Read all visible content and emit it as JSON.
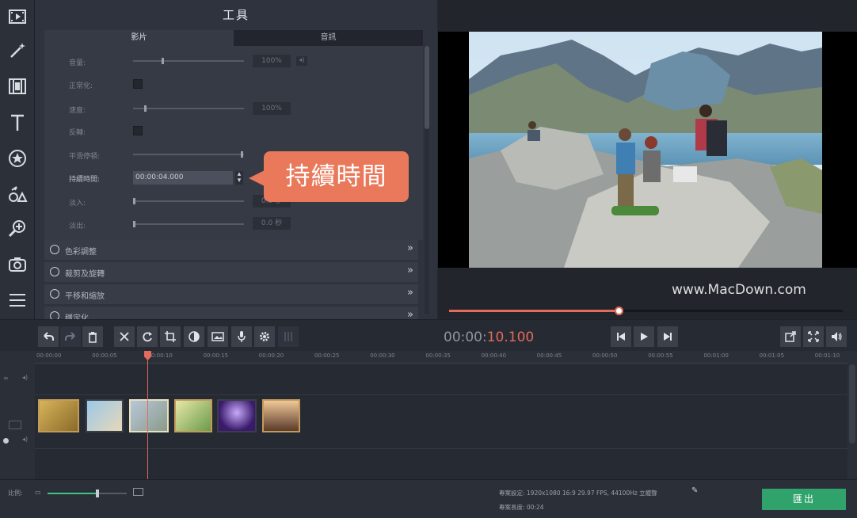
{
  "colors": {
    "accent": "#e46a5a",
    "export_green": "#2fa36b",
    "callout": "#e9795a"
  },
  "left_toolbar": {
    "icons": [
      "film-import-icon",
      "magic-wand-icon",
      "filmstrip-icon",
      "text-icon",
      "sticker-icon",
      "transitions-icon",
      "zoom-icon",
      "camera-icon",
      "menu-icon"
    ]
  },
  "tools_panel": {
    "title": "工具",
    "tabs": [
      {
        "label": "影片"
      },
      {
        "label": "音訊"
      }
    ],
    "properties": {
      "volume": {
        "label": "音量:",
        "value": "100%",
        "level": 0.26
      },
      "normalize": {
        "label": "正常化:"
      },
      "speed": {
        "label": "速度:",
        "value": "100%",
        "level": 0.1
      },
      "reverse": {
        "label": "反轉:"
      },
      "ripple": {
        "label": "平滑停頓:",
        "value": ""
      },
      "duration": {
        "label": "持續時間:",
        "value": "00:00:04.000"
      },
      "fade_in": {
        "label": "淡入:",
        "value": "0.0 秒"
      },
      "fade_out": {
        "label": "淡出:",
        "value": "0.0 秒"
      }
    },
    "sections": [
      {
        "label": "色彩調整"
      },
      {
        "label": "裁剪及旋轉"
      },
      {
        "label": "平移和縮放"
      },
      {
        "label": "穩定化"
      }
    ]
  },
  "callout": {
    "text": "持續時間"
  },
  "preview": {
    "watermark": "www.MacDown.com",
    "progress": 0.43
  },
  "transport": {
    "timecode_main": "00:00:",
    "timecode_ms": "10.100"
  },
  "timeline": {
    "ticks": [
      "00:00:00",
      "00:00:05",
      "00:00:10",
      "00:00:15",
      "00:00:20",
      "00:00:25",
      "00:00:30",
      "00:00:35",
      "00:00:40",
      "00:00:45",
      "00:00:50",
      "00:00:55",
      "00:01:00",
      "00:01:05",
      "00:01:10"
    ]
  },
  "bottom_bar": {
    "zoom_label": "比例:",
    "zoom_level": 0.63,
    "project_settings": "專案設定:   1920x1080 16:9 29.97 FPS, 44100Hz 立體聲",
    "project_length": "專案長度:   00:24",
    "export_label": "匯出"
  }
}
